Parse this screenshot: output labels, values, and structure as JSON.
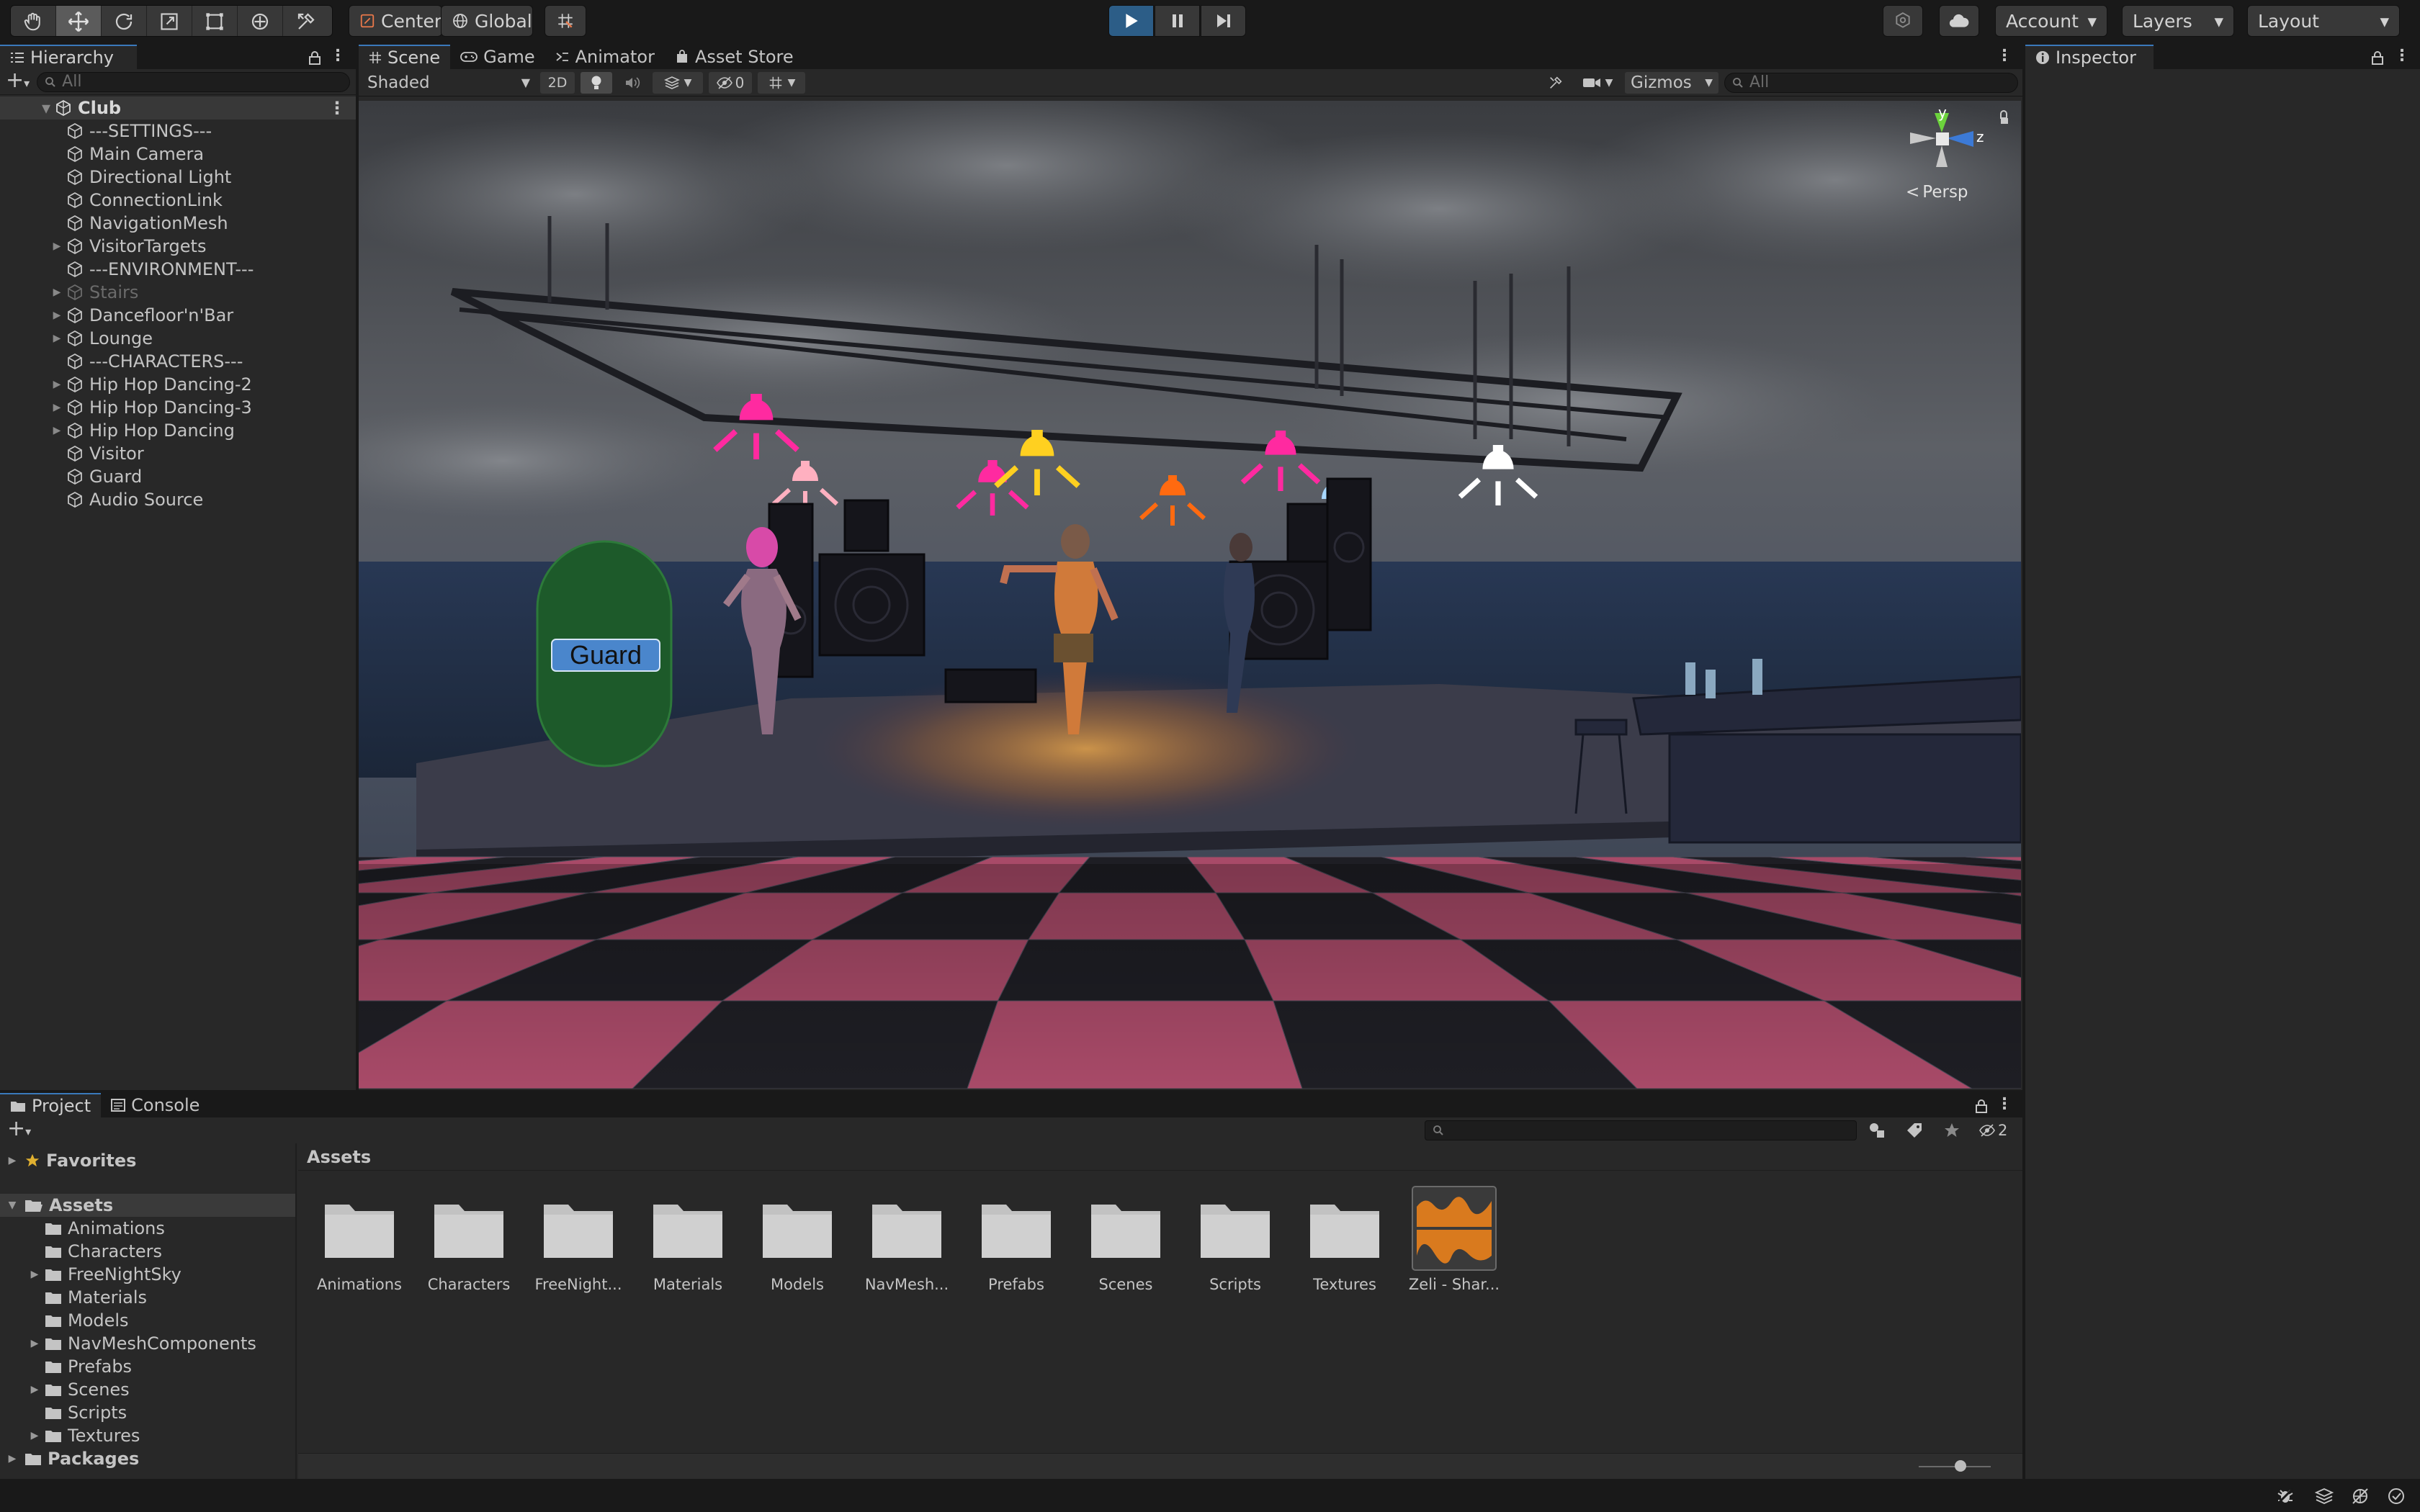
{
  "toolbar": {
    "tools": [
      "hand-tool",
      "move-tool",
      "rotate-tool",
      "scale-tool",
      "rect-tool",
      "transform-tool",
      "custom-tool"
    ],
    "pivot_label": "Center",
    "space_label": "Global",
    "account_label": "Account",
    "layers_label": "Layers",
    "layout_label": "Layout"
  },
  "hierarchy": {
    "tab_label": "Hierarchy",
    "search_placeholder": "All",
    "scene_name": "Club",
    "items": [
      {
        "label": "---SETTINGS---",
        "foldable": false,
        "dim": false
      },
      {
        "label": "Main Camera",
        "foldable": false,
        "dim": false
      },
      {
        "label": "Directional Light",
        "foldable": false,
        "dim": false
      },
      {
        "label": "ConnectionLink",
        "foldable": false,
        "dim": false
      },
      {
        "label": "NavigationMesh",
        "foldable": false,
        "dim": false
      },
      {
        "label": "VisitorTargets",
        "foldable": true,
        "dim": false
      },
      {
        "label": "---ENVIRONMENT---",
        "foldable": false,
        "dim": false
      },
      {
        "label": "Stairs",
        "foldable": true,
        "dim": true
      },
      {
        "label": "Dancefloor'n'Bar",
        "foldable": true,
        "dim": false
      },
      {
        "label": "Lounge",
        "foldable": true,
        "dim": false
      },
      {
        "label": "---CHARACTERS---",
        "foldable": false,
        "dim": false
      },
      {
        "label": "Hip Hop Dancing-2",
        "foldable": true,
        "dim": false
      },
      {
        "label": "Hip Hop Dancing-3",
        "foldable": true,
        "dim": false
      },
      {
        "label": "Hip Hop Dancing",
        "foldable": true,
        "dim": false
      },
      {
        "label": "Visitor",
        "foldable": false,
        "dim": false
      },
      {
        "label": "Guard",
        "foldable": false,
        "dim": false
      },
      {
        "label": "Audio Source",
        "foldable": false,
        "dim": false
      }
    ]
  },
  "scene_view": {
    "tabs": [
      "Scene",
      "Game",
      "Animator",
      "Asset Store"
    ],
    "shading_mode": "Shaded",
    "mode_2d": "2D",
    "hidden_count": "0",
    "gizmos_label": "Gizmos",
    "search_placeholder": "All",
    "projection_label": "Persp",
    "axis_y": "y",
    "axis_z": "z",
    "guard_label": "Guard"
  },
  "inspector": {
    "tab_label": "Inspector"
  },
  "project": {
    "tabs": [
      "Project",
      "Console"
    ],
    "favorites_label": "Favorites",
    "assets_label": "Assets",
    "packages_label": "Packages",
    "breadcrumb": "Assets",
    "hidden_count": "2",
    "tree": [
      {
        "label": "Animations",
        "foldable": false
      },
      {
        "label": "Characters",
        "foldable": false
      },
      {
        "label": "FreeNightSky",
        "foldable": true
      },
      {
        "label": "Materials",
        "foldable": false
      },
      {
        "label": "Models",
        "foldable": false
      },
      {
        "label": "NavMeshComponents",
        "foldable": true
      },
      {
        "label": "Prefabs",
        "foldable": false
      },
      {
        "label": "Scenes",
        "foldable": true
      },
      {
        "label": "Scripts",
        "foldable": false
      },
      {
        "label": "Textures",
        "foldable": true
      }
    ],
    "assets": [
      {
        "label": "Animations",
        "kind": "folder"
      },
      {
        "label": "Characters",
        "kind": "folder"
      },
      {
        "label": "FreeNight...",
        "kind": "folder"
      },
      {
        "label": "Materials",
        "kind": "folder"
      },
      {
        "label": "Models",
        "kind": "folder"
      },
      {
        "label": "NavMesh...",
        "kind": "folder"
      },
      {
        "label": "Prefabs",
        "kind": "folder"
      },
      {
        "label": "Scenes",
        "kind": "folder"
      },
      {
        "label": "Scripts",
        "kind": "folder"
      },
      {
        "label": "Textures",
        "kind": "folder"
      },
      {
        "label": "Zeli - Shar...",
        "kind": "audio"
      }
    ]
  },
  "colors": {
    "accent": "#3a79bb",
    "play_active": "#2c5d87",
    "guard_capsule": "#1d5a2a",
    "audio_clip": "#d97a1e"
  }
}
